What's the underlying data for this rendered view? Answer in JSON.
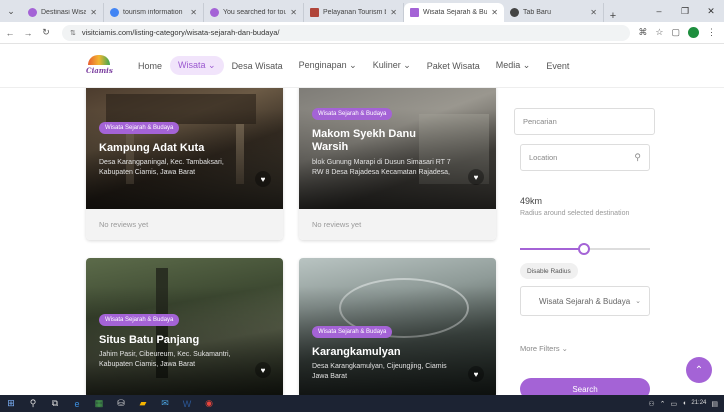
{
  "browser": {
    "tabs": [
      {
        "label": "Destinasi Wisata Arc",
        "color": "#a463d6",
        "active": false
      },
      {
        "label": "tourism information",
        "color": "#4285f4",
        "active": false
      },
      {
        "label": "You searched for tou",
        "color": "#a463d6",
        "active": false
      },
      {
        "label": "Pelayanan Tourism b",
        "color": "#b0453a",
        "active": false
      },
      {
        "label": "Wisata Sejarah & Bu",
        "color": "#a463d6",
        "active": true
      },
      {
        "label": "Tab Baru",
        "color": "#444",
        "active": false
      }
    ],
    "url": "visitciamis.com/listing-category/wisata-sejarah-dan-budaya/"
  },
  "site": {
    "logo_text": "Ciamis",
    "nav": [
      {
        "label": "Home",
        "active": false
      },
      {
        "label": "Wisata ⌄",
        "active": true
      },
      {
        "label": "Desa Wisata",
        "active": false
      },
      {
        "label": "Penginapan ⌄",
        "active": false
      },
      {
        "label": "Kuliner ⌄",
        "active": false
      },
      {
        "label": "Paket Wisata",
        "active": false
      },
      {
        "label": "Media ⌄",
        "active": false
      },
      {
        "label": "Event",
        "active": false
      }
    ]
  },
  "listings": [
    {
      "badge": "Wisata Sejarah & Budaya",
      "title": "Kampung Adat Kuta",
      "address": "Desa Karangpaningal, Kec. Tambaksari, Kabupaten Ciamis, Jawa Barat",
      "reviews": "No reviews yet"
    },
    {
      "badge": "Wisata Sejarah & Budaya",
      "title": "Makom Syekh Danu Warsih",
      "address": "blok Gunung Marapi di Dusun Simasari RT 7 RW 8 Desa Rajadesa Kecamatan Rajadesa,",
      "reviews": "No reviews yet"
    },
    {
      "badge": "Wisata Sejarah & Budaya",
      "title": "Situs Batu Panjang",
      "address": "Jahim Pasir, Cibeureum, Kec. Sukamantri, Kabupaten Ciamis, Jawa Barat"
    },
    {
      "badge": "Wisata Sejarah & Budaya",
      "title": "Karangkamulyan",
      "address": "Desa Karangkamulyan, Cijeungjing, Ciamis Jawa Barat"
    }
  ],
  "filters": {
    "search_placeholder": "Pencarian",
    "location_placeholder": "Location",
    "radius_value": "49km",
    "radius_label": "Radius around selected destination",
    "radius_fraction": 0.49,
    "disable_radius": "Disable Radius",
    "category_selected": "Wisata Sejarah & Budaya",
    "more_filters": "More Filters ⌄",
    "search_button": "Search"
  },
  "taskbar": {
    "time": "21:24"
  },
  "colors": {
    "accent": "#a463d6"
  }
}
